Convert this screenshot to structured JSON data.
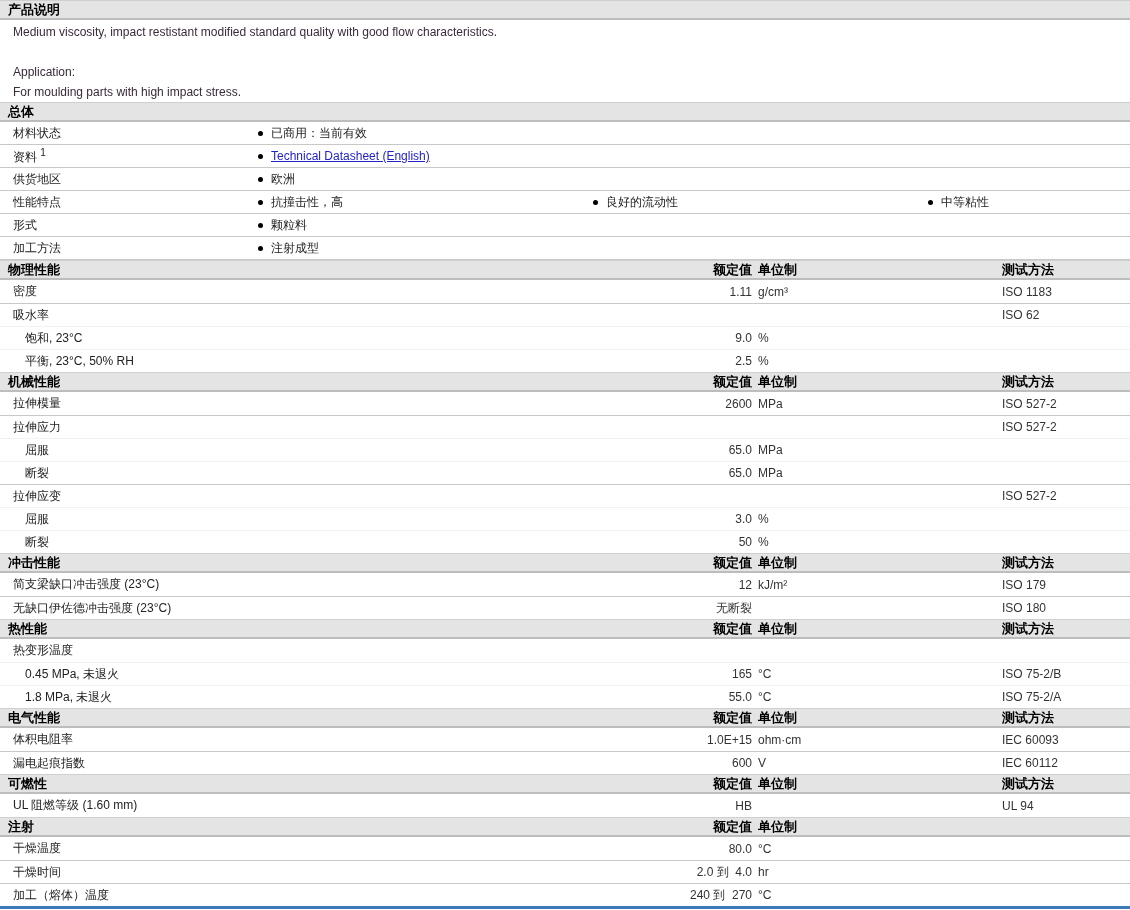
{
  "description": {
    "heading": "产品说明",
    "paragraphs": [
      [
        "Medium viscosity, impact restistant modified standard quality with good flow characteristics."
      ],
      [
        "Application:",
        "For moulding parts with high impact stress."
      ]
    ]
  },
  "general": {
    "heading": "总体",
    "rows": [
      {
        "label": "材料状态",
        "values": [
          {
            "kind": "text",
            "text": "已商用：当前有效"
          }
        ]
      },
      {
        "label": "资料 $^{1}$",
        "values": [
          {
            "kind": "link",
            "text": "Technical Datasheet (English)"
          }
        ]
      },
      {
        "label": "供货地区",
        "values": [
          {
            "kind": "text",
            "text": "欧洲"
          }
        ]
      },
      {
        "label": "性能特点",
        "values": [
          {
            "kind": "text",
            "text": "抗撞击性，高"
          },
          {
            "kind": "text",
            "text": "良好的流动性"
          },
          {
            "kind": "text",
            "text": "中等粘性"
          }
        ]
      },
      {
        "label": "形式",
        "values": [
          {
            "kind": "text",
            "text": "颗粒料"
          }
        ]
      },
      {
        "label": "加工方法",
        "values": [
          {
            "kind": "text",
            "text": "注射成型"
          }
        ]
      }
    ]
  },
  "sections": [
    {
      "heading": "物理性能",
      "value_column": "额定值",
      "unit_column": "单位制",
      "method_column": "测试方法",
      "rows": [
        {
          "label": "密度",
          "value": "1.11",
          "unit": "g/cm³",
          "method": "ISO 1183"
        },
        {
          "label": "吸水率",
          "method": "ISO 62",
          "children": [
            {
              "label": "饱和, 23°C",
              "value": "9.0",
              "unit": "%"
            },
            {
              "label": "平衡, 23°C, 50% RH",
              "value": "2.5",
              "unit": "%"
            }
          ]
        }
      ]
    },
    {
      "heading": "机械性能",
      "value_column": "额定值",
      "unit_column": "单位制",
      "method_column": "测试方法",
      "rows": [
        {
          "label": "拉伸模量",
          "value": "2600",
          "unit": "MPa",
          "method": "ISO 527-2"
        },
        {
          "label": "拉伸应力",
          "method": "ISO 527-2",
          "children": [
            {
              "label": "屈服",
              "value": "65.0",
              "unit": "MPa"
            },
            {
              "label": "断裂",
              "value": "65.0",
              "unit": "MPa"
            }
          ]
        },
        {
          "label": "拉伸应变",
          "method": "ISO 527-2",
          "children": [
            {
              "label": "屈服",
              "value": "3.0",
              "unit": "%"
            },
            {
              "label": "断裂",
              "value": "50",
              "unit": "%"
            }
          ]
        }
      ]
    },
    {
      "heading": "冲击性能",
      "value_column": "额定值",
      "unit_column": "单位制",
      "method_column": "测试方法",
      "rows": [
        {
          "label": "简支梁缺口冲击强度 (23°C)",
          "value": "12",
          "unit": "kJ/m²",
          "method": "ISO 179"
        },
        {
          "label": "无缺口伊佐德冲击强度 (23°C)",
          "value": "无断裂",
          "method": "ISO 180"
        }
      ]
    },
    {
      "heading": "热性能",
      "value_column": "额定值",
      "unit_column": "单位制",
      "method_column": "测试方法",
      "rows": [
        {
          "label": "热变形温度",
          "children": [
            {
              "label": "0.45 MPa, 未退火",
              "value": "165",
              "unit": "°C",
              "method": "ISO 75-2/B"
            },
            {
              "label": "1.8 MPa, 未退火",
              "value": "55.0",
              "unit": "°C",
              "method": "ISO 75-2/A"
            }
          ]
        }
      ]
    },
    {
      "heading": "电气性能",
      "value_column": "额定值",
      "unit_column": "单位制",
      "method_column": "测试方法",
      "rows": [
        {
          "label": "体积电阻率",
          "value": "1.0E+15",
          "unit": "ohm·cm",
          "method": "IEC 60093"
        },
        {
          "label": "漏电起痕指数",
          "value": "600",
          "unit": "V",
          "method": "IEC 60112"
        }
      ]
    },
    {
      "heading": "可燃性",
      "value_column": "额定值",
      "unit_column": "单位制",
      "method_column": "测试方法",
      "rows": [
        {
          "label": "UL 阻燃等级 (1.60 mm)",
          "value": "HB",
          "method": "UL 94"
        }
      ]
    },
    {
      "heading": "注射",
      "value_column": "额定值",
      "unit_column": "单位制",
      "rows": [
        {
          "label": "干燥温度",
          "value": "80.0",
          "unit": "°C"
        },
        {
          "label": "干燥时间",
          "value": "2.0 到  4.0",
          "unit": "hr"
        },
        {
          "label": "加工（熔体）温度",
          "value": "240 到  270",
          "unit": "°C"
        }
      ]
    }
  ]
}
